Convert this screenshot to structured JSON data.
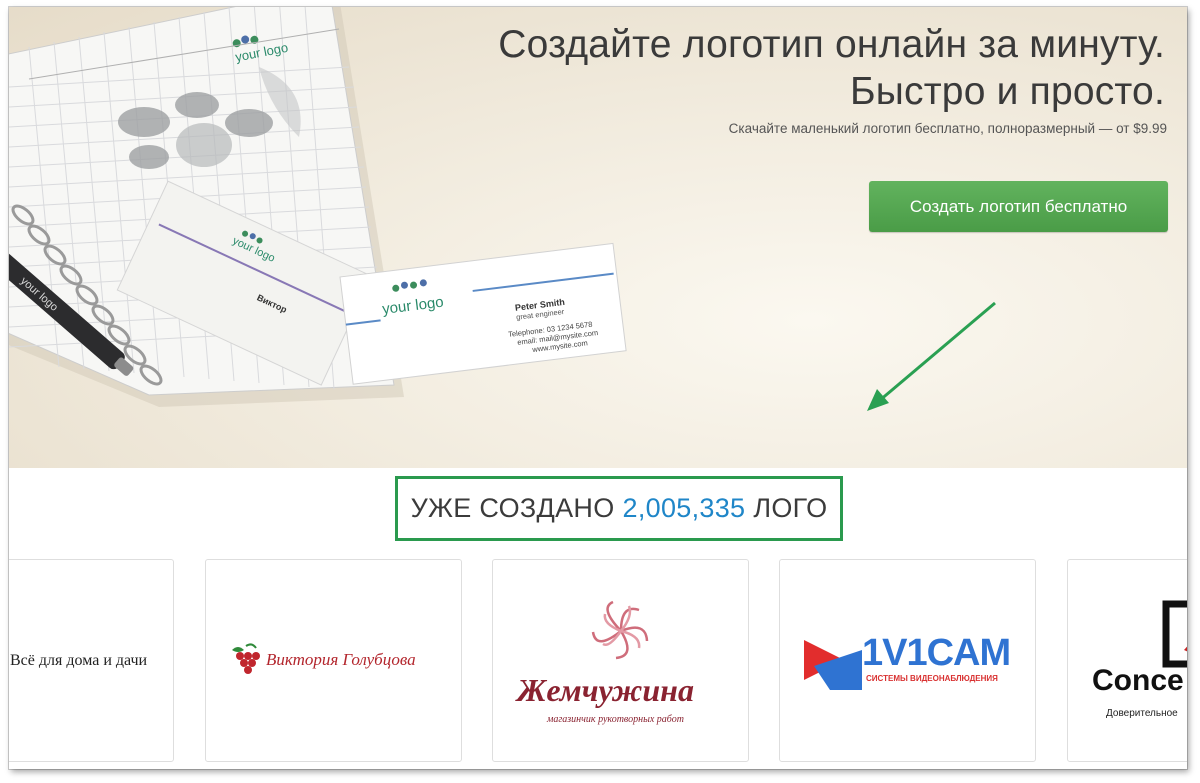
{
  "hero": {
    "title_line1": "Создайте логотип онлайн за минуту.",
    "title_line2": "Быстро и просто.",
    "subtitle": "Скачайте маленький логотип бесплатно, полноразмерный — от $9.99",
    "cta_label": "Создать логотип бесплатно",
    "mockup": {
      "logo_text": "your logo",
      "pen_text": "your logo",
      "back_card_name": "Виктор",
      "front_card_name": "Peter Smith",
      "front_card_role": "great engineer",
      "front_card_phone": "Telephone: 03 1234 5678",
      "front_card_email": "email: mail@mysite.com",
      "front_card_site": "www.mysite.com"
    }
  },
  "counter": {
    "prefix": "УЖЕ СОЗДАНО",
    "value": "2,005,335",
    "suffix": "ЛОГО"
  },
  "logos": [
    {
      "text": "Всё для дома и дачи"
    },
    {
      "text": "Виктория Голубцова"
    },
    {
      "text": "Жемчужина",
      "tagline": "магазинчик рукотворных работ"
    },
    {
      "text": "1V1CAM",
      "tagline": "СИСТЕМЫ ВИДЕОНАБЛЮДЕНИЯ"
    },
    {
      "text": "Conce",
      "tagline": "Доверительное"
    }
  ],
  "colors": {
    "cta_green": "#5aae57",
    "counter_border": "#2a9a4e",
    "counter_number": "#1f86c8",
    "arrow_green": "#2aa052"
  }
}
